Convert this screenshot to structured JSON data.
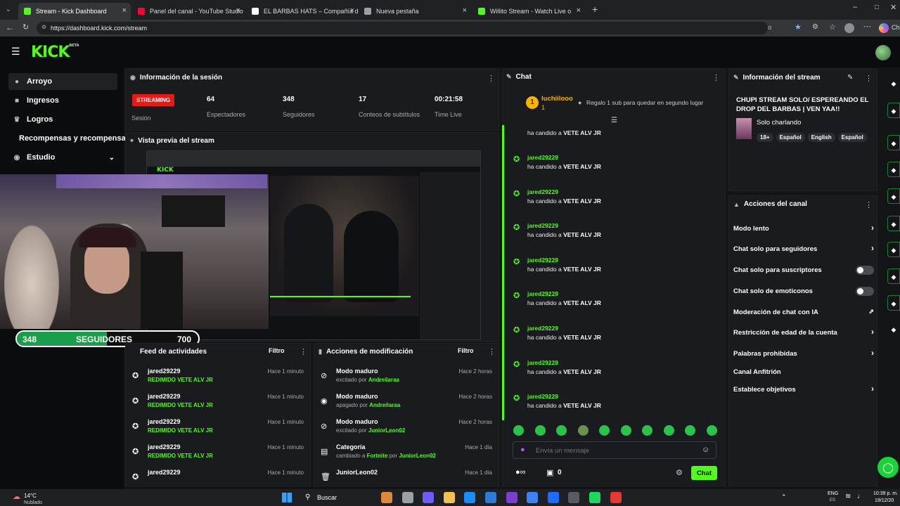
{
  "browser": {
    "tabs": [
      {
        "title": "Stream - Kick Dashboard",
        "color": "#53fc18",
        "active": true
      },
      {
        "title": "Panel del canal - YouTube Studio",
        "color": "#ff0033"
      },
      {
        "title": "EL BARBAS HATS – Compañía de",
        "color": "#ffffff"
      },
      {
        "title": "Nueva pestaña",
        "color": "#9aa0a6"
      },
      {
        "title": "Willito Stream - Watch Live o",
        "color": "#53fc18"
      }
    ],
    "url": "https://dashboard.kick.com/stream",
    "profile_label": "Ch"
  },
  "kick": {
    "logo": "KICK",
    "logo_sup": "BETA"
  },
  "sidebar": {
    "items": [
      {
        "label": "Arroyo",
        "icon": "stream-icon",
        "active": true
      },
      {
        "label": "Ingresos",
        "icon": "revenue-icon"
      },
      {
        "label": "Logros",
        "icon": "trophy-icon"
      },
      {
        "label": "Recompensas y recompensas",
        "icon": ""
      },
      {
        "label": "Estudio",
        "icon": "studio-icon"
      }
    ]
  },
  "session": {
    "title": "Información de la sesión",
    "status_badge": "STREAMING",
    "status_label": "Sesión",
    "stats": [
      {
        "value": "64",
        "label": "Espectadores"
      },
      {
        "value": "348",
        "label": "Seguidores"
      },
      {
        "value": "17",
        "label": "Conteos de subtítulos"
      },
      {
        "value": "00:21:58",
        "label": "Time Live"
      }
    ]
  },
  "preview": {
    "title": "Vista previa del stream"
  },
  "overlay": {
    "current": "348",
    "label": "SEGUIDORES",
    "goal": "700",
    "progress": 0.497
  },
  "feed": {
    "title": "Feed de actividades",
    "filter": "Filtro",
    "items": [
      {
        "user": "jared29229",
        "action": "REDIMIDO VETE ALV JR",
        "time": "Hace 1 minuto"
      },
      {
        "user": "jared29229",
        "action": "REDIMIDO VETE ALV JR",
        "time": "Hace 1 minuto"
      },
      {
        "user": "jared29229",
        "action": "REDIMIDO VETE ALV JR",
        "time": "Hace 1 minuto"
      },
      {
        "user": "jared29229",
        "action": "REDIMIDO VETE ALV JR",
        "time": "Hace 1 minuto"
      },
      {
        "user": "jared29229",
        "action": "",
        "time": "Hace 1 minuto"
      }
    ]
  },
  "mod": {
    "title": "Acciones de modificación",
    "filter": "Filtro",
    "items": [
      {
        "title": "Modo maduro",
        "verb": "excitado por",
        "user": "Andreilaraa",
        "time": "Hace 2 horas",
        "icon": "eye-off-icon"
      },
      {
        "title": "Modo maduro",
        "verb": "apagado por",
        "user": "Andreilaraa",
        "time": "Hace 2 horas",
        "icon": "eye-icon"
      },
      {
        "title": "Modo maduro",
        "verb": "excitado por",
        "user": "JuniorLeon02",
        "time": "Hace 2 horas",
        "icon": "eye-off-icon"
      },
      {
        "title": "Categoría",
        "verb": "cambiado a",
        "extra": "Fortnite",
        "verb2": "por",
        "user": "JuniorLeon02",
        "time": "Hace 1 día",
        "icon": "category-icon"
      },
      {
        "title": "JuniorLeon02",
        "verb": "",
        "user": "",
        "time": "Hace 1 día",
        "icon": "trash-icon"
      }
    ]
  },
  "chat": {
    "title": "Chat",
    "pinned_user": "luchiilooo",
    "pinned_rank": "1",
    "gift_text": "Regalo 1 sub para quedar en segundo lugar",
    "top_text": "ha candido a",
    "top_target": "VETE ALV JR",
    "messages": [
      {
        "user": "jared29229",
        "text": "ha candido a",
        "target": "VETE ALV JR"
      },
      {
        "user": "jared29229",
        "text": "ha candido a",
        "target": "VETE ALV JR"
      },
      {
        "user": "jared29229",
        "text": "ha candido a",
        "target": "VETE ALV JR"
      },
      {
        "user": "jared29229",
        "text": "ha candido a",
        "target": "VETE ALV JR"
      },
      {
        "user": "jared29229",
        "text": "ha candido a",
        "target": "VETE ALV JR"
      },
      {
        "user": "jared29229",
        "text": "ha candido a",
        "target": "VETE ALV JR"
      },
      {
        "user": "jared29229",
        "text": "ha candido a",
        "target": "VETE ALV JR"
      },
      {
        "user": "jared29229",
        "text": "ha candido a",
        "target": "VETE ALV JR"
      }
    ],
    "placeholder": "Envía un mensaje",
    "count": "0",
    "send": "Chat"
  },
  "stream_info": {
    "title": "Información del stream",
    "stream_title": "CHUPI STREAM SOLO/ ESPEREANDO EL DROP DEL BARBAS | VEN YAA!!",
    "category": "Solo charlando",
    "tags": [
      "18+",
      "Español",
      "English",
      "Español"
    ]
  },
  "actions": {
    "title": "Acciones del canal",
    "items": [
      {
        "label": "Modo lento",
        "control": "arrow"
      },
      {
        "label": "Chat solo para seguidores",
        "control": "arrow"
      },
      {
        "label": "Chat solo para suscriptores",
        "control": "toggle"
      },
      {
        "label": "Chat solo de emoticonos",
        "control": "toggle"
      },
      {
        "label": "Moderación de chat con IA",
        "control": "external"
      },
      {
        "label": "Restricción de edad de la cuenta",
        "control": "arrow"
      },
      {
        "label": "Palabras prohibidas",
        "control": "arrow"
      },
      {
        "label": "Canal Anfitrión",
        "control": "none"
      },
      {
        "label": "Establece objetivos",
        "control": "arrow"
      }
    ]
  },
  "taskbar": {
    "weather_temp": "14°C",
    "weather_desc": "Nublado",
    "search": "Buscar",
    "lang": "ENG",
    "lang_sub": "ES",
    "time": "10:39 p. m.",
    "date": "19/12/20"
  }
}
